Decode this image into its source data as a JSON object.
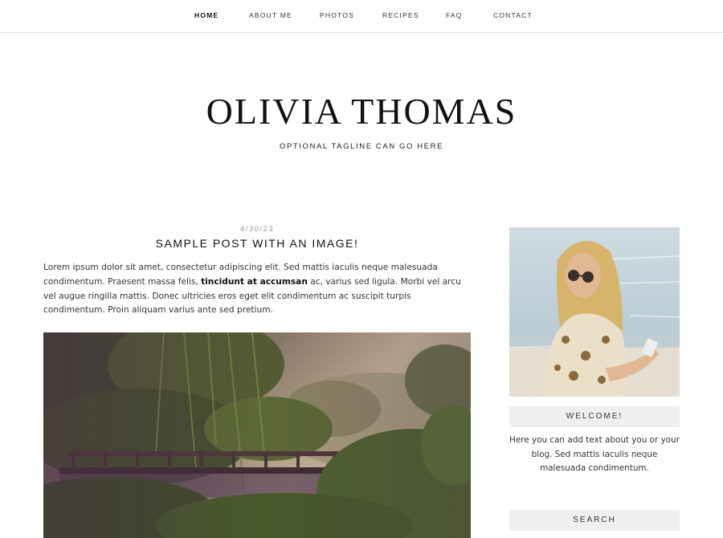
{
  "nav": {
    "items": [
      {
        "label": "HOME",
        "active": true
      },
      {
        "label": "ABOUT ME",
        "active": false
      },
      {
        "label": "PHOTOS",
        "active": false
      },
      {
        "label": "RECIPES",
        "active": false
      },
      {
        "label": "FAQ",
        "active": false
      },
      {
        "label": "CONTACT",
        "active": false
      }
    ]
  },
  "header": {
    "title": "OLIVIA THOMAS",
    "tagline": "OPTIONAL TAGLINE CAN GO HERE"
  },
  "post": {
    "date": "4/30/23",
    "title": "SAMPLE POST WITH AN IMAGE!",
    "body_before": "Lorem ipsum dolor sit amet, consectetur adipiscing elit. Sed mattis iaculis neque malesuada condimentum. Praesent massa felis, ",
    "body_bold": "tincidunt at accumsan",
    "body_after": " ac, varius sed ligula. Morbi vel arcu vel augue ringilla mattis. Donec ultricies eros eget elit condimentum ac suscipit turpis condimentum. Proin aliquam varius ante sed pretium."
  },
  "sidebar": {
    "welcome_title": "WELCOME!",
    "welcome_text": "Here you can add text about you or your blog. Sed mattis iaculis neque malesuada condimentum.",
    "search_title": "SEARCH"
  }
}
